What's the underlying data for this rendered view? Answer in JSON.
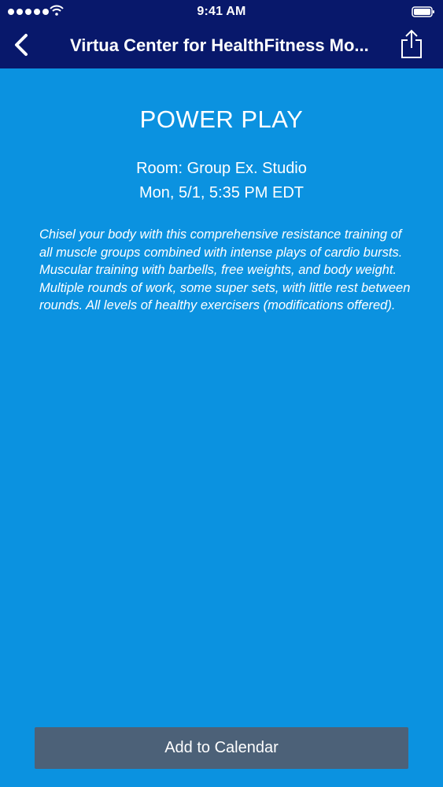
{
  "status_bar": {
    "time": "9:41 AM",
    "signal_icon": "cellular-signal-icon",
    "wifi_icon": "wifi-icon",
    "battery_icon": "battery-icon"
  },
  "nav": {
    "title": "Virtua Center for HealthFitness Mo...",
    "back_icon": "chevron-left-icon",
    "share_icon": "share-icon"
  },
  "event": {
    "title": "POWER PLAY",
    "room": "Room: Group Ex. Studio",
    "datetime": "Mon, 5/1, 5:35 PM EDT",
    "description": "Chisel your body with this comprehensive resistance training of all muscle groups combined with intense plays of cardio bursts.  Muscular training with barbells, free weights, and body weight.  Multiple rounds of work, some super sets, with little rest between rounds.  All levels of healthy exercisers (modifications offered)."
  },
  "actions": {
    "add_to_calendar_label": "Add to Calendar"
  },
  "colors": {
    "nav_background": "#08186b",
    "content_background": "#0b92e0",
    "button_background": "#4c6178",
    "text": "#ffffff"
  }
}
